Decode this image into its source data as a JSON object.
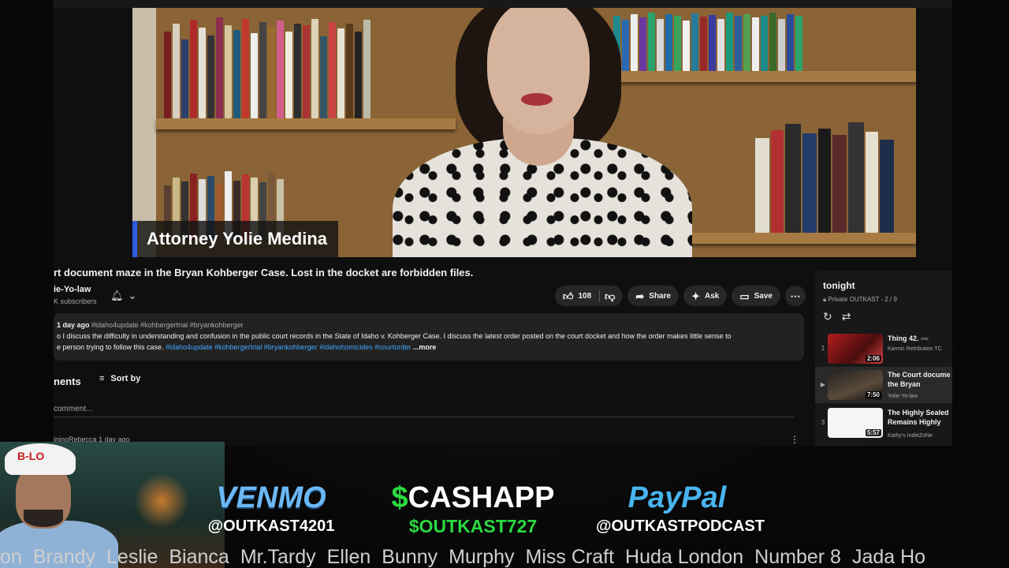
{
  "video": {
    "lower_third_name": "Attorney Yolie Medina",
    "title": "rt document maze in the Bryan Kohberger Case. Lost in the docket are forbidden files."
  },
  "channel": {
    "name": "ie-Yo-law",
    "subscribers": "K subscribers"
  },
  "actions": {
    "like_count": "108",
    "share_label": "Share",
    "ask_label": "Ask",
    "save_label": "Save"
  },
  "description": {
    "meta": "1 day ago",
    "meta_tags": "#idaho4update #kohbergertrial #bryankohberger",
    "line1": "o I discuss the difficulty in understanding and confusion in the public court records in the State of Idaho v. Kohberger Case. I discuss the latest order posted on the court docket and how the order makes little sense to",
    "line2_text": "e person trying to follow this case.",
    "line2_tags": "#idaho4update #kohbergertrial #bryankohberger #idahohomicides #courtorder",
    "more": "...more"
  },
  "comments": {
    "heading": "nents",
    "sort_label": "Sort by",
    "placeholder": "comment...",
    "first_commenter": "ininoRebecca",
    "first_time": "1 day ago"
  },
  "playlist": {
    "title": "tonight",
    "subtitle": "Private OUTKAST - 2 / 9",
    "items": [
      {
        "index": "1",
        "title": "Thing 42. ▫▫▫",
        "channel": "Karmic Retribution TC",
        "duration": "2:06"
      },
      {
        "index": "▶",
        "title": "The Court docume the Bryan Kohberg",
        "channel": "Yolie-Yo-law",
        "duration": "7:50"
      },
      {
        "index": "3",
        "title": "The Highly Sealed Remains Highly Se",
        "channel": "Kathy's IndieZoNe",
        "duration": "5:57"
      }
    ]
  },
  "webcam": {
    "cap_text": "B-LO"
  },
  "donations": {
    "venmo_brand": "VENMO",
    "venmo_handle": "@OUTKAST4201",
    "cashapp_symbol": "$",
    "cashapp_brand": "CASHAPP",
    "cashapp_handle": "$OUTKAST727",
    "paypal_brand": "PayPal",
    "paypal_handle": "@OUTKASTPODCAST"
  },
  "ticker": [
    "on",
    "Brandy",
    "Leslie",
    "Bianca",
    "Mr.Tardy",
    "Ellen",
    "Bunny",
    "Murphy",
    "Miss Craft",
    "Huda London",
    "Number 8",
    "Jada Ho"
  ],
  "colors": {
    "accent_blue": "#3ea6ff",
    "cashapp_green": "#2bd940",
    "venmo_blue": "#6cb8f5",
    "paypal_blue": "#49b4ef"
  }
}
